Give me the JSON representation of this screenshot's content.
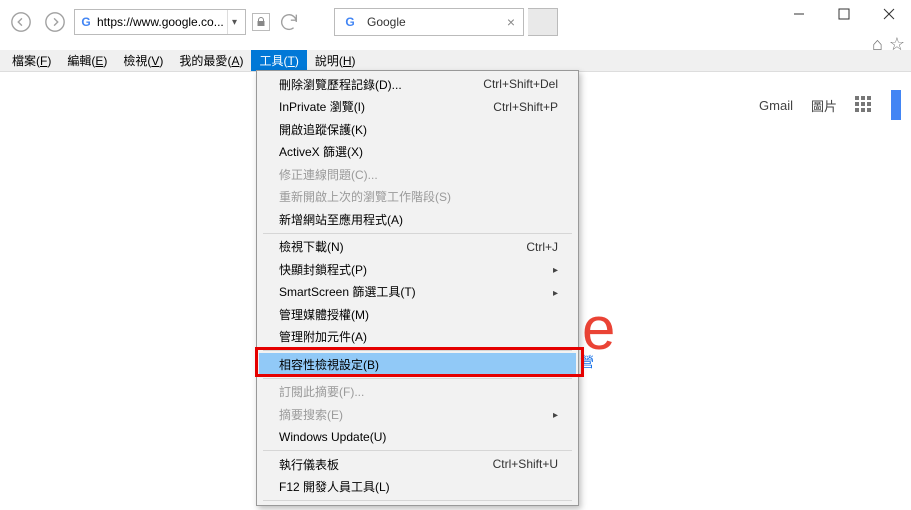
{
  "window": {
    "url": "https://www.google.co...",
    "tab_title": "Google"
  },
  "menubar": {
    "file": {
      "label": "檔案",
      "accel": "F"
    },
    "edit": {
      "label": "編輯",
      "accel": "E"
    },
    "view": {
      "label": "檢視",
      "accel": "V"
    },
    "fav": {
      "label": "我的最愛",
      "accel": "A"
    },
    "tools": {
      "label": "工具",
      "accel": "T"
    },
    "help": {
      "label": "說明",
      "accel": "H"
    }
  },
  "tools_menu": {
    "delete_history": {
      "label": "刪除瀏覽歷程記錄(D)...",
      "shortcut": "Ctrl+Shift+Del"
    },
    "inprivate": {
      "label": "InPrivate 瀏覽(I)",
      "shortcut": "Ctrl+Shift+P"
    },
    "tracking": {
      "label": "開啟追蹤保護(K)"
    },
    "activex": {
      "label": "ActiveX 篩選(X)"
    },
    "fix_conn": {
      "label": "修正連線問題(C)...",
      "disabled": true
    },
    "reopen": {
      "label": "重新開啟上次的瀏覽工作階段(S)",
      "disabled": true
    },
    "add_site_app": {
      "label": "新增網站至應用程式(A)"
    },
    "view_dl": {
      "label": "檢視下載(N)",
      "shortcut": "Ctrl+J"
    },
    "popup": {
      "label": "快顯封鎖程式(P)",
      "submenu": true
    },
    "smartscreen": {
      "label": "SmartScreen 篩選工具(T)",
      "submenu": true
    },
    "media_lic": {
      "label": "管理媒體授權(M)"
    },
    "addons": {
      "label": "管理附加元件(A)"
    },
    "compat": {
      "label": "相容性檢視設定(B)",
      "highlight": true
    },
    "feed": {
      "label": "訂閱此摘要(F)...",
      "disabled": true
    },
    "feed_search": {
      "label": "摘要搜索(E)",
      "disabled": true,
      "submenu": true
    },
    "wupdate": {
      "label": "Windows Update(U)"
    },
    "perf": {
      "label": "執行儀表板",
      "shortcut": "Ctrl+Shift+U"
    },
    "f12": {
      "label": "F12 開發人員工具(L)"
    }
  },
  "page": {
    "gmail": "Gmail",
    "images": "圖片",
    "big_e_glyph": "e",
    "blue_glyph": "營"
  }
}
